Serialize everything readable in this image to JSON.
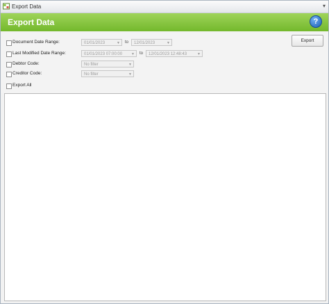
{
  "window": {
    "title": "Export Data"
  },
  "header": {
    "title": "Export Data",
    "help": "?"
  },
  "toolbar": {
    "export_label": "Export"
  },
  "filters": {
    "document_date_range": {
      "label": "Document Date Range:",
      "from": "01/01/2023",
      "to": "12/01/2023",
      "separator": "to"
    },
    "last_modified_date_range": {
      "label": "Last Modified Date Range:",
      "from": "01/01/2023 07:00:00",
      "to": "12/01/2023 12:48:43",
      "separator": "to"
    },
    "debtor_code": {
      "label": "Debtor Code:",
      "value": "No filter"
    },
    "creditor_code": {
      "label": "Creditor Code:",
      "value": "No filter"
    },
    "export_all": {
      "label": "Export All"
    }
  }
}
